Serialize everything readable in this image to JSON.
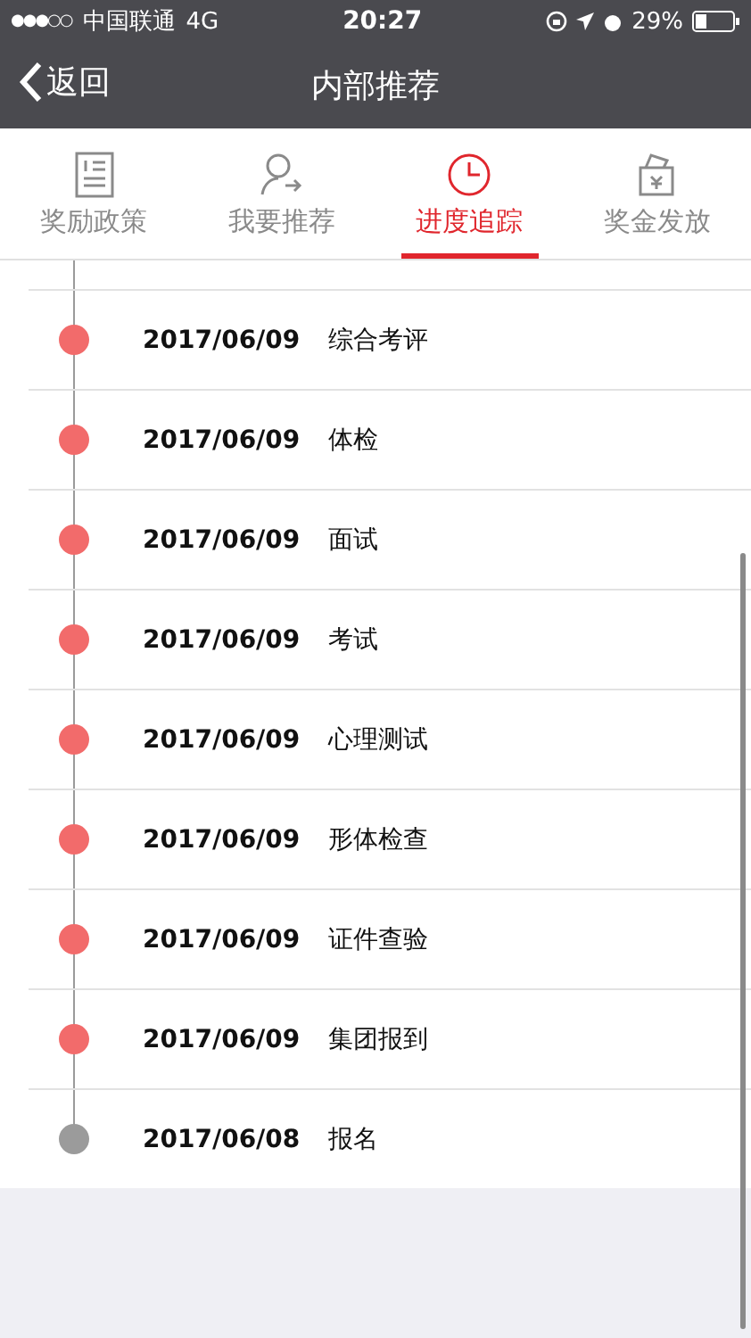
{
  "status_bar": {
    "signal": "●●●○○",
    "carrier": "中国联通",
    "network": "4G",
    "time": "20:27",
    "battery": "29%"
  },
  "nav": {
    "back": "返回",
    "title": "内部推荐"
  },
  "tabs": [
    {
      "label": "奖励政策",
      "selected": false
    },
    {
      "label": "我要推荐",
      "selected": false
    },
    {
      "label": "进度追踪",
      "selected": true
    },
    {
      "label": "奖金发放",
      "selected": false
    }
  ],
  "timeline": [
    {
      "date": "2017/06/09",
      "step": "综合考评",
      "color": "#f26b6b"
    },
    {
      "date": "2017/06/09",
      "step": "体检",
      "color": "#f26b6b"
    },
    {
      "date": "2017/06/09",
      "step": "面试",
      "color": "#f26b6b"
    },
    {
      "date": "2017/06/09",
      "step": "考试",
      "color": "#f26b6b"
    },
    {
      "date": "2017/06/09",
      "step": "心理测试",
      "color": "#f26b6b"
    },
    {
      "date": "2017/06/09",
      "step": "形体检查",
      "color": "#f26b6b"
    },
    {
      "date": "2017/06/09",
      "step": "证件查验",
      "color": "#f26b6b"
    },
    {
      "date": "2017/06/09",
      "step": "集团报到",
      "color": "#f26b6b"
    },
    {
      "date": "2017/06/08",
      "step": "报名",
      "color": "#9b9b9b"
    }
  ]
}
